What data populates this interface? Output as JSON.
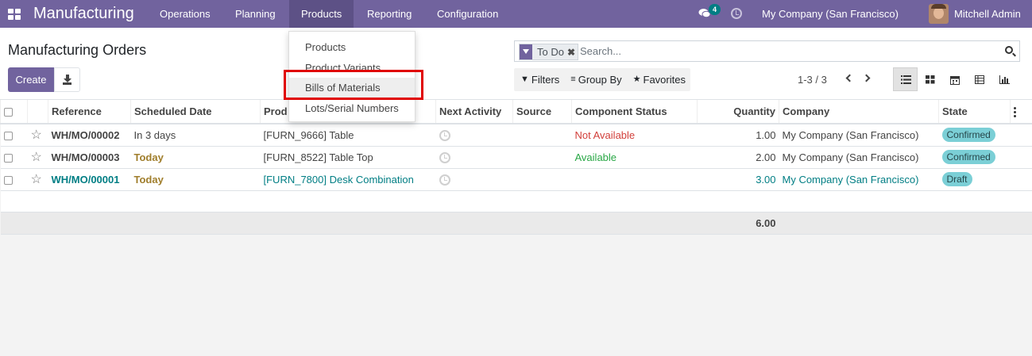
{
  "navbar": {
    "brand": "Manufacturing",
    "menus": [
      "Operations",
      "Planning",
      "Products",
      "Reporting",
      "Configuration"
    ],
    "active_menu": "Products",
    "message_count": "4",
    "company": "My Company (San Francisco)",
    "user": "Mitchell Admin",
    "accent_color": "#71639e"
  },
  "control_panel": {
    "title": "Manufacturing Orders",
    "create_label": "Create",
    "search": {
      "facet": "To Do",
      "placeholder": "Search..."
    },
    "filters_label": "Filters",
    "groupby_label": "Group By",
    "favorites_label": "Favorites",
    "pager": "1-3 / 3",
    "views": [
      "list",
      "kanban",
      "calendar",
      "pivot",
      "graph"
    ],
    "active_view": "list"
  },
  "products_dropdown": {
    "items": [
      "Products",
      "Product Variants",
      "Bills of Materials",
      "Lots/Serial Numbers"
    ],
    "highlighted": "Bills of Materials"
  },
  "table": {
    "columns": [
      "Reference",
      "Scheduled Date",
      "Prod",
      "Next Activity",
      "Source",
      "Component Status",
      "Quantity",
      "Company",
      "State"
    ],
    "rows": [
      {
        "reference": "WH/MO/00002",
        "scheduled": "In 3 days",
        "product": "[FURN_9666] Table",
        "component_status": "Not Available",
        "quantity": "1.00",
        "company": "My Company (San Francisco)",
        "state": "Confirmed"
      },
      {
        "reference": "WH/MO/00003",
        "scheduled": "Today",
        "product": "[FURN_8522] Table Top",
        "component_status": "Available",
        "quantity": "2.00",
        "company": "My Company (San Francisco)",
        "state": "Confirmed"
      },
      {
        "reference": "WH/MO/00001",
        "scheduled": "Today",
        "product": "[FURN_7800] Desk Combination",
        "component_status": "",
        "quantity": "3.00",
        "company": "My Company (San Francisco)",
        "state": "Draft"
      }
    ],
    "total_quantity": "6.00"
  }
}
